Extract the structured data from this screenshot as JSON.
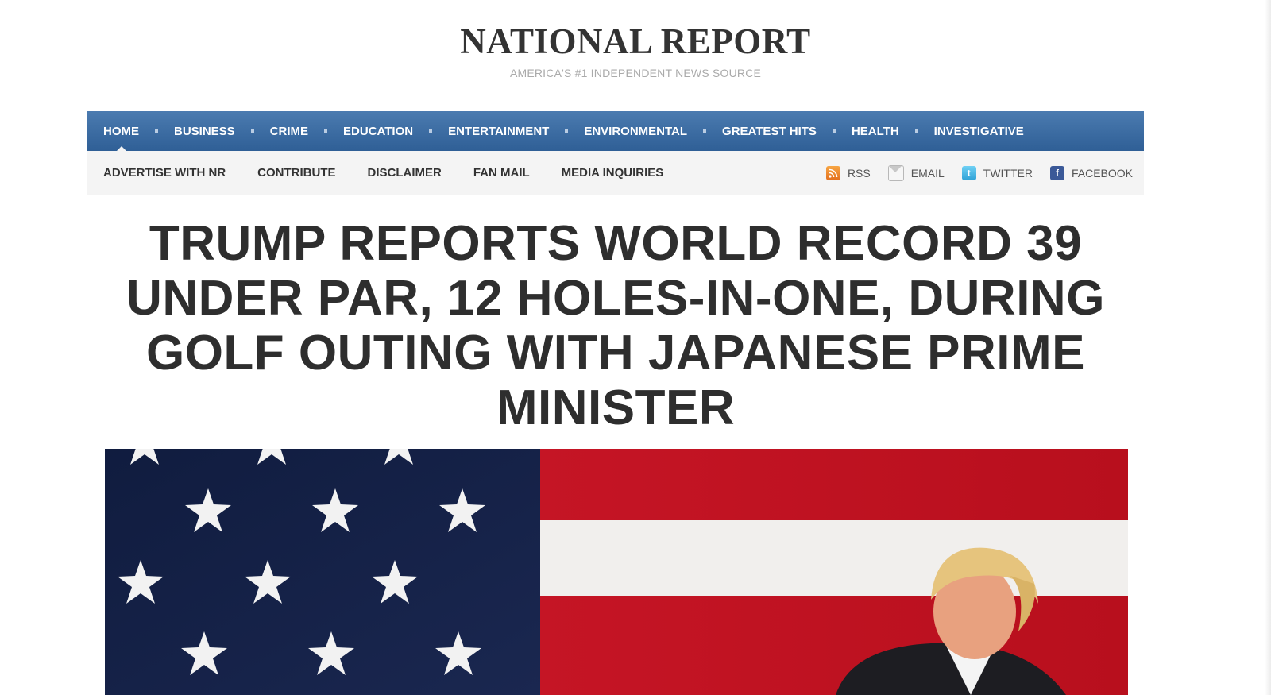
{
  "site": {
    "title": "NATIONAL REPORT",
    "tagline": "AMERICA'S #1 INDEPENDENT NEWS SOURCE"
  },
  "main_nav": {
    "items": [
      {
        "label": "HOME",
        "active": true
      },
      {
        "label": "BUSINESS"
      },
      {
        "label": "CRIME"
      },
      {
        "label": "EDUCATION"
      },
      {
        "label": "ENTERTAINMENT"
      },
      {
        "label": "ENVIRONMENTAL"
      },
      {
        "label": "GREATEST HITS"
      },
      {
        "label": "HEALTH"
      },
      {
        "label": "INVESTIGATIVE"
      }
    ],
    "bg_color": "#3d6da4"
  },
  "sub_nav": {
    "items": [
      {
        "label": "ADVERTISE WITH NR"
      },
      {
        "label": "CONTRIBUTE"
      },
      {
        "label": "DISCLAIMER"
      },
      {
        "label": "FAN MAIL"
      },
      {
        "label": "MEDIA INQUIRIES"
      }
    ],
    "social": [
      {
        "label": "RSS",
        "icon": "rss-icon"
      },
      {
        "label": "EMAIL",
        "icon": "email-icon"
      },
      {
        "label": "TWITTER",
        "icon": "twitter-icon"
      },
      {
        "label": "FACEBOOK",
        "icon": "facebook-icon"
      }
    ]
  },
  "article": {
    "headline": "TRUMP REPORTS WORLD RECORD 39 UNDER PAR, 12 HOLES-IN-ONE, DURING GOLF OUTING WITH JAPANESE PRIME MINISTER"
  }
}
